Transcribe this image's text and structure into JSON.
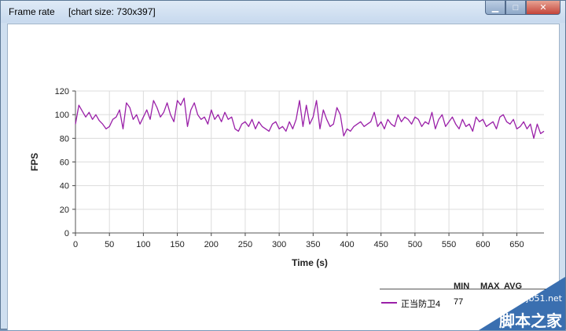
{
  "window": {
    "title": "Frame rate",
    "info": "[chart size: 730x397]",
    "buttons": {
      "minimize": "▁",
      "maximize": "□",
      "close": "✕"
    }
  },
  "chart_data": {
    "type": "line",
    "xlabel": "Time (s)",
    "ylabel": "FPS",
    "xlim": [
      0,
      690
    ],
    "ylim": [
      0,
      120
    ],
    "x_ticks": [
      0,
      50,
      100,
      150,
      200,
      250,
      300,
      350,
      400,
      450,
      500,
      550,
      600,
      650
    ],
    "y_ticks": [
      0,
      20,
      40,
      60,
      80,
      100,
      120
    ],
    "grid": true,
    "series": [
      {
        "name": "正当防卫4",
        "color": "#9a20a8",
        "x": [
          0,
          5,
          10,
          15,
          20,
          25,
          30,
          35,
          40,
          45,
          50,
          55,
          60,
          65,
          70,
          75,
          80,
          85,
          90,
          95,
          100,
          105,
          110,
          115,
          120,
          125,
          130,
          135,
          140,
          145,
          150,
          155,
          160,
          165,
          170,
          175,
          180,
          185,
          190,
          195,
          200,
          205,
          210,
          215,
          220,
          225,
          230,
          235,
          240,
          245,
          250,
          255,
          260,
          265,
          270,
          275,
          280,
          285,
          290,
          295,
          300,
          305,
          310,
          315,
          320,
          325,
          330,
          335,
          340,
          345,
          350,
          355,
          360,
          365,
          370,
          375,
          380,
          385,
          390,
          395,
          400,
          405,
          410,
          415,
          420,
          425,
          430,
          435,
          440,
          445,
          450,
          455,
          460,
          465,
          470,
          475,
          480,
          485,
          490,
          495,
          500,
          505,
          510,
          515,
          520,
          525,
          530,
          535,
          540,
          545,
          550,
          555,
          560,
          565,
          570,
          575,
          580,
          585,
          590,
          595,
          600,
          605,
          610,
          615,
          620,
          625,
          630,
          635,
          640,
          645,
          650,
          655,
          660,
          665,
          670,
          675,
          680,
          685,
          690
        ],
        "y": [
          92,
          108,
          103,
          98,
          102,
          96,
          100,
          95,
          92,
          88,
          90,
          96,
          98,
          104,
          88,
          110,
          106,
          96,
          100,
          92,
          98,
          104,
          96,
          112,
          106,
          98,
          102,
          110,
          100,
          94,
          112,
          108,
          114,
          90,
          104,
          110,
          100,
          96,
          98,
          92,
          104,
          96,
          100,
          94,
          102,
          96,
          98,
          88,
          86,
          92,
          94,
          90,
          96,
          88,
          94,
          90,
          88,
          86,
          92,
          94,
          88,
          90,
          86,
          94,
          88,
          96,
          112,
          90,
          108,
          92,
          98,
          112,
          88,
          104,
          96,
          90,
          92,
          106,
          100,
          82,
          88,
          86,
          90,
          92,
          94,
          90,
          92,
          94,
          102,
          90,
          94,
          88,
          96,
          92,
          90,
          100,
          94,
          98,
          96,
          92,
          98,
          96,
          90,
          94,
          92,
          102,
          88,
          96,
          100,
          90,
          94,
          98,
          92,
          88,
          96,
          90,
          92,
          86,
          98,
          94,
          96,
          90,
          92,
          94,
          88,
          98,
          100,
          94,
          92,
          96,
          88,
          90,
          94,
          88,
          92,
          80,
          92,
          84,
          86
        ]
      }
    ],
    "legend": {
      "headers": [
        "MIN",
        "MAX",
        "AVG"
      ],
      "min_value": "77"
    }
  },
  "watermark": {
    "url": "jb51.net",
    "name": "脚本之家"
  }
}
